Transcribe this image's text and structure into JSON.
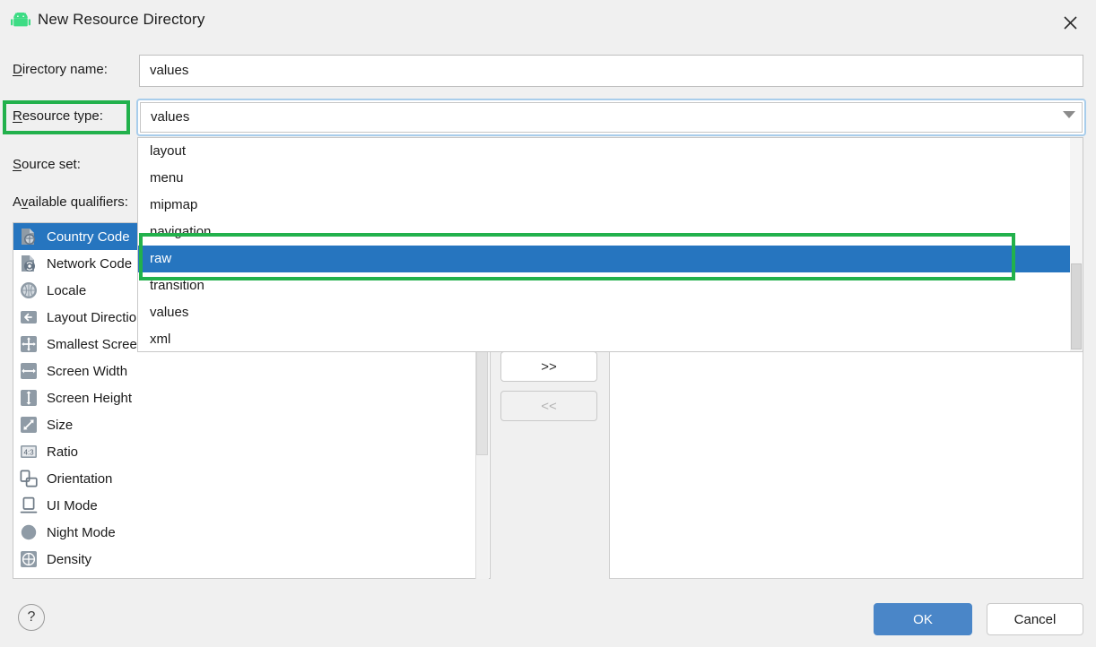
{
  "window": {
    "title": "New Resource Directory",
    "app_icon": "android-robot-icon",
    "close_icon": "close-icon"
  },
  "form": {
    "directory_name": {
      "label": "Directory name:",
      "mnemonic": "D",
      "value": "values"
    },
    "resource_type": {
      "label": "Resource type:",
      "mnemonic": "R",
      "value": "values",
      "arrow_icon": "chevron-down-icon",
      "options": [
        "layout",
        "menu",
        "mipmap",
        "navigation",
        "raw",
        "transition",
        "values",
        "xml"
      ],
      "highlighted_option": "raw"
    },
    "source_set": {
      "label": "Source set:",
      "mnemonic": "S"
    },
    "available_qualifiers": {
      "label": "Available qualifiers:",
      "mnemonic": "v"
    }
  },
  "qualifiers": {
    "selected": "Country Code",
    "items": [
      {
        "label": "Country Code",
        "icon": "country-code-icon"
      },
      {
        "label": "Network Code",
        "icon": "network-code-icon"
      },
      {
        "label": "Locale",
        "icon": "locale-globe-icon"
      },
      {
        "label": "Layout Direction",
        "icon": "layout-direction-arrow-icon"
      },
      {
        "label": "Smallest Screen Width",
        "icon": "smallest-screen-width-icon"
      },
      {
        "label": "Screen Width",
        "icon": "screen-width-icon"
      },
      {
        "label": "Screen Height",
        "icon": "screen-height-icon"
      },
      {
        "label": "Size",
        "icon": "size-diagonal-icon"
      },
      {
        "label": "Ratio",
        "icon": "ratio-icon"
      },
      {
        "label": "Orientation",
        "icon": "orientation-icon"
      },
      {
        "label": "UI Mode",
        "icon": "ui-mode-icon"
      },
      {
        "label": "Night Mode",
        "icon": "night-mode-icon"
      },
      {
        "label": "Density",
        "icon": "density-icon"
      }
    ]
  },
  "transfer": {
    "add_label": ">>",
    "remove_label": "<<"
  },
  "footer": {
    "help_label": "?",
    "ok_label": "OK",
    "cancel_label": "Cancel"
  },
  "annotations": {
    "color": "#22b14c",
    "boxes": [
      "resource-type-label",
      "raw-option-row"
    ]
  },
  "colors": {
    "selection_blue": "#2675bf",
    "ok_button": "#4a86c8",
    "focus_ring": "#a8cdeb",
    "android_green": "#3ddc84",
    "dialog_background": "#f0f0f0"
  }
}
